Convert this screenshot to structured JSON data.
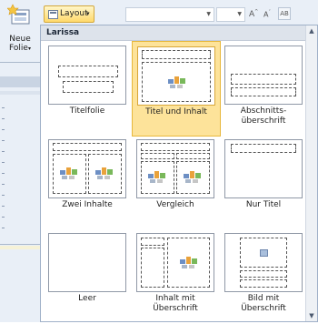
{
  "ribbon": {
    "new_slide_label": "Neue\nFolie",
    "new_slide_caret": "▾",
    "layout_button_label": "Layout",
    "layout_caret": "▾",
    "grow_font": "A",
    "shrink_font": "A",
    "clear_format": "AB"
  },
  "gallery": {
    "header": "Larissa",
    "layouts": [
      {
        "label": "Titelfolie",
        "selected": false
      },
      {
        "label": "Titel und Inhalt",
        "selected": true
      },
      {
        "label": "Abschnitts-\nüberschrift",
        "selected": false
      },
      {
        "label": "Zwei Inhalte",
        "selected": false
      },
      {
        "label": "Vergleich",
        "selected": false
      },
      {
        "label": "Nur Titel",
        "selected": false
      },
      {
        "label": "Leer",
        "selected": false
      },
      {
        "label": "Inhalt mit\nÜberschrift",
        "selected": false
      },
      {
        "label": "Bild mit\nÜberschrift",
        "selected": false
      }
    ]
  },
  "colors": {
    "selection_fill": "#fde39a",
    "selection_border": "#e7b83c",
    "ribbon_bg": "#e9eff7"
  }
}
